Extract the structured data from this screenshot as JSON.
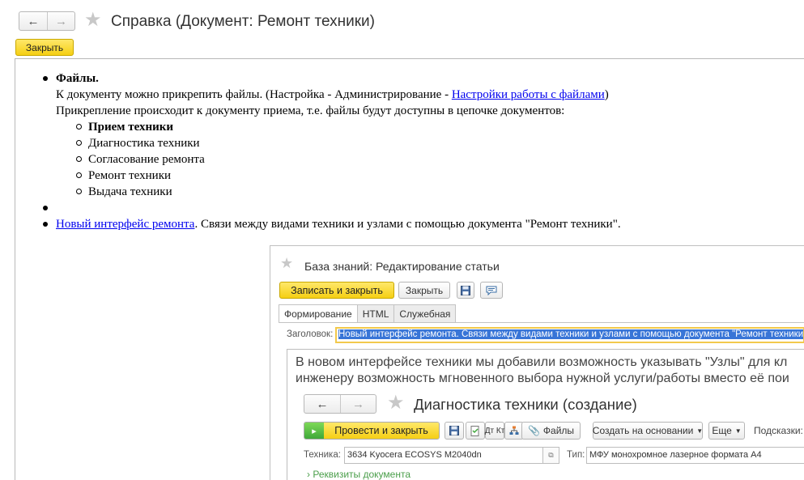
{
  "window": {
    "title": "Справка (Документ: Ремонт техники)",
    "nav_back": "←",
    "nav_forward": "→",
    "close_button": "Закрыть"
  },
  "help": {
    "files_heading": "Файлы.",
    "files_line1_prefix": "К документу можно прикрепить файлы. (Настройка - Администрирование - ",
    "files_line1_link": "Настройки работы с файлами",
    "files_line1_suffix": ")",
    "files_line2": "Прикрепление происходит к документу приема, т.е. файлы будут доступны в цепочке документов:",
    "chain": [
      "Прием техники",
      "Диагностика техники",
      "Согласование ремонта",
      "Ремонт техники",
      "Выдача техники"
    ],
    "new_ui_link": "Новый интерфейс ремонта",
    "new_ui_text": ". Связи между видами техники и узлами с помощью документа \"Ремонт техники\"."
  },
  "kb": {
    "title": "База знаний: Редактирование статьи",
    "save_close": "Записать и закрыть",
    "close": "Закрыть",
    "tabs": [
      "Формирование",
      "HTML",
      "Служебная"
    ],
    "header_label": "Заголовок:",
    "header_value": "Новый интерфейс ремонта. Связи между видами техники и узлами с помощью документа \"Ремонт техники\".",
    "editor_line1": "В новом интерфейсе техники мы добавили возможность указывать \"Узлы\" для кл",
    "editor_line2": "инженеру возможность мгновенного выбора нужной услуги/работы вместо её пои"
  },
  "inner_form": {
    "title": "Диагностика техники (создание)",
    "post_close": "Провести и закрыть",
    "dt_kt": "Дт Кт",
    "files": "Файлы",
    "create_based": "Создать на основании",
    "more": "Еще",
    "hints": "Подсказки:",
    "tech_label": "Техника:",
    "tech_value": "3634 Kyocera ECOSYS M2040dn",
    "type_label": "Тип:",
    "type_value": "МФУ монохромное лазерное формата А4",
    "requisites": "Реквизиты документа"
  }
}
